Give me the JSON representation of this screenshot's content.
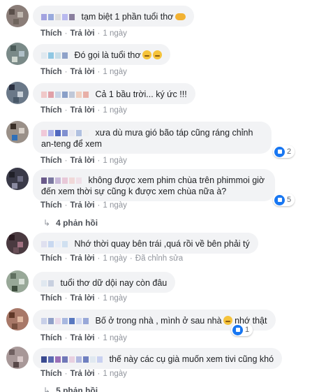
{
  "comments": [
    {
      "text": "tạm biệt 1 phần tuổi thơ",
      "like": "Thích",
      "reply": "Trả lời",
      "time": "1 ngày",
      "name_colors": [
        "#a3a3e0",
        "#9ad",
        "#ddd",
        "#b9b9ef",
        "#8a7f9e"
      ]
    },
    {
      "text": "Đó gọi là tuổi thơ",
      "like": "Thích",
      "reply": "Trả lời",
      "time": "1 ngày",
      "name_colors": [
        "#dfe8ef",
        "#8fc7e3",
        "#c7dde8",
        "#8fa2c9"
      ]
    },
    {
      "text": "Cả 1 bầu trời... ký ức !!!",
      "like": "Thích",
      "reply": "Trả lời",
      "time": "1 ngày",
      "name_colors": [
        "#f0c8c8",
        "#e0a0a8",
        "#c8d4e6",
        "#8aa0c8",
        "#c0c8d8",
        "#f0d0c0",
        "#e8b0a8"
      ]
    },
    {
      "text": "xưa dù mưa gió bão táp cũng ráng chỉnh an-teng để xem",
      "like": "Thích",
      "reply": "Trả lời",
      "time": "1 ngày",
      "reaction": "2",
      "name_colors": [
        "#f0c8d8",
        "#a8b0e8",
        "#5068c0",
        "#8090d0",
        "#e8e8f0",
        "#b0c0e0",
        "#f0f0f0"
      ]
    },
    {
      "text": "không được xem phim chùa trên phimmoi giờ đến xem thời sự cũng k được xem chùa nữa à?",
      "like": "Thích",
      "reply": "Trả lời",
      "time": "1 ngày",
      "reaction": "5",
      "name_colors": [
        "#6a5a8a",
        "#7a78a0",
        "#c8b8d8",
        "#e8c8d8",
        "#f0d8d8",
        "#f0e0e8"
      ]
    },
    {
      "text": "Nhớ thời quay bên trái ,quá rồi về bên phải tý",
      "like": "Thích",
      "reply": "Trả lời",
      "time": "1 ngày",
      "name_colors": [
        "#dfe0ef",
        "#c8d8f0",
        "#e8eef8",
        "#d0e0f0"
      ]
    },
    {
      "text": "tuổi thơ dữ dội nay còn đâu",
      "like": "Thích",
      "reply": "Trả lời",
      "time": "1 ngày",
      "edited": "Đã chỉnh sửa",
      "name_colors": [
        "#e0e8f0",
        "#c8d0e0"
      ]
    },
    {
      "text": "Bố ở trong nhà , mình ở sau nhà",
      "text2": "nhớ thật",
      "like": "Thích",
      "reply": "Trả lời",
      "time": "1 ngày",
      "reaction": "1",
      "name_colors": [
        "#c8d0e8",
        "#90a0c8",
        "#e8d8e8",
        "#a8b8e0",
        "#5878c0",
        "#d0d8f0",
        "#98a8d8"
      ]
    },
    {
      "text": "thế này các cụ già muốn xem tivi cũng khó",
      "like": "Thích",
      "reply": "Trả lời",
      "time": "1 ngày",
      "name_colors": [
        "#3a4a90",
        "#5a6ab0",
        "#9a70b8",
        "#7078b8",
        "#e8d0e0",
        "#b0b8e0",
        "#7080c0",
        "#e0e8f0",
        "#c8d0f0"
      ]
    }
  ],
  "reply_links": [
    "4 phản hồi",
    "5 phản hồi"
  ],
  "icons": {
    "arrow": "↳"
  }
}
